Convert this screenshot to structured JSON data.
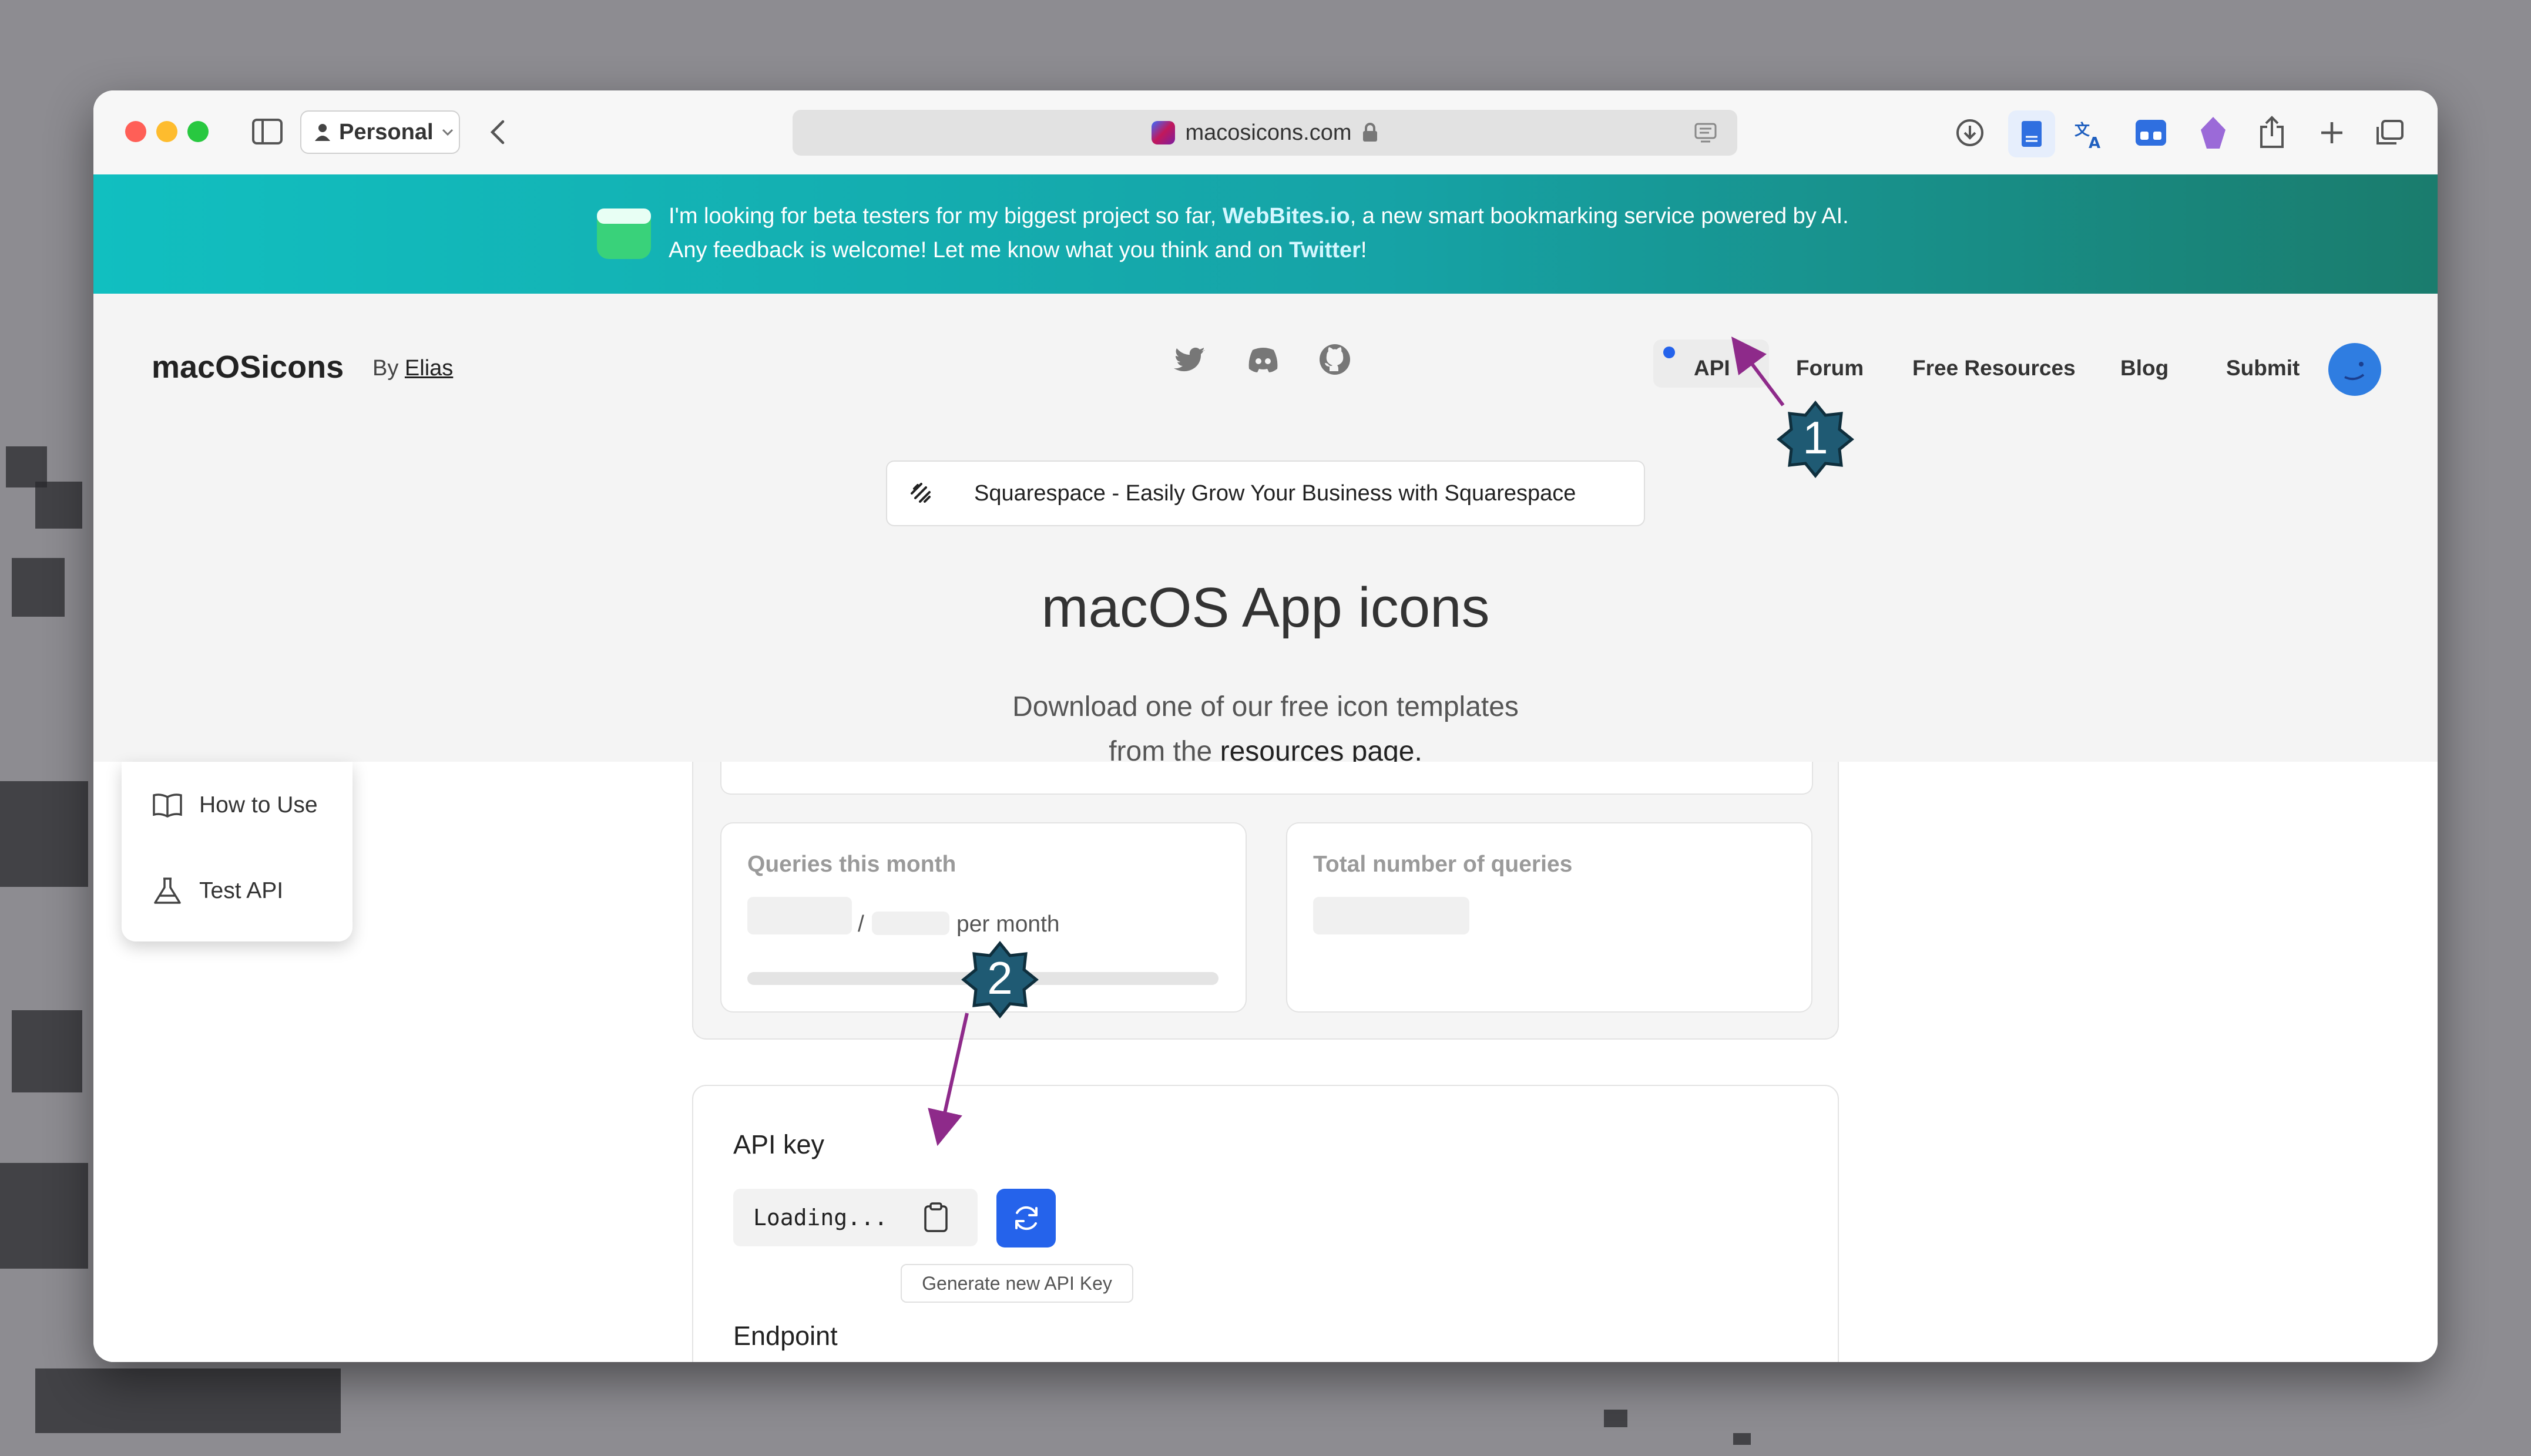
{
  "browser": {
    "profile_label": "Personal",
    "url": "macosicons.com"
  },
  "banner": {
    "line1_pre": "I'm looking for beta testers for my biggest project so far, ",
    "line1_link": "WebBites.io",
    "line1_post": ", a new smart bookmarking service powered by AI.",
    "line2_pre": "Any feedback is welcome! Let me know what you think and on ",
    "line2_link": "Twitter",
    "line2_post": "!"
  },
  "header": {
    "brand": "macOSicons",
    "by_label": "By",
    "author": "Elias",
    "nav": {
      "api": "API",
      "forum": "Forum",
      "free_resources": "Free Resources",
      "blog": "Blog",
      "submit": "Submit"
    }
  },
  "ad": {
    "text": "Squarespace - Easily Grow Your Business with Squarespace"
  },
  "hero": {
    "title": "macOS App icons",
    "subtitle_line1": "Download one of our free icon templates",
    "subtitle_pre": "from the ",
    "subtitle_link": "resources page."
  },
  "sidebar": {
    "items": [
      {
        "label": "How to Use"
      },
      {
        "label": "Test API"
      }
    ]
  },
  "stats": {
    "queries_month_label": "Queries this month",
    "slash": "/",
    "per_month": "per month",
    "total_queries_label": "Total number of queries",
    "progress_fraction": 0
  },
  "api_key": {
    "title": "API key",
    "value": "Loading...",
    "tooltip": "Generate new API Key",
    "endpoint_title": "Endpoint"
  },
  "annotations": {
    "marker1": "1",
    "marker2": "2",
    "color": "#1f5a73",
    "arrow_color": "#8e2a8a"
  },
  "colors": {
    "accent": "#2563eb",
    "banner_start": "#11bfc0",
    "banner_end": "#1a7c6d"
  }
}
